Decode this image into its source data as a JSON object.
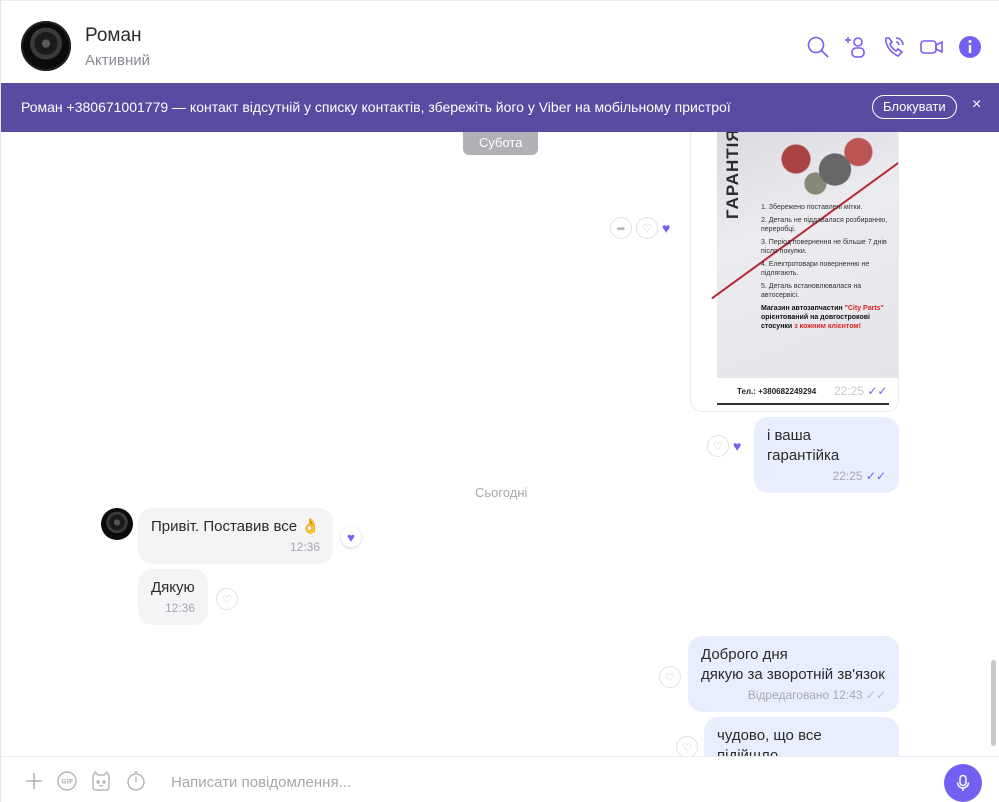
{
  "header": {
    "contact_name": "Роман",
    "contact_status": "Активний",
    "icons": [
      "search-icon",
      "add-participant-icon",
      "voice-call-icon",
      "video-call-icon",
      "info-icon"
    ]
  },
  "banner": {
    "text": "Роман +380671001779 — контакт відсутній у списку контактів, збережіть його у Viber на мобільному пристрої",
    "block_label": "Блокувати",
    "close_glyph": "×"
  },
  "chat": {
    "date_saturday": "Субота",
    "date_today": "Сьогодні",
    "image_message": {
      "poster_title": "ГАРАНТІЯ",
      "poster_items": [
        "1. Збережено поставлені мітки.",
        "2. Деталь не піддавалася розбиранню, переробці.",
        "3. Період повернення не більше 7 днів після покупки.",
        "4. Електротовари поверненню не підлягають.",
        "5. Деталь встановлювалася на автосервісі."
      ],
      "poster_promo_a": "Магазин автозапчастин ",
      "poster_promo_brand": "\"City Parts\"",
      "poster_promo_b": " орієнтований на довгострокові стосунки ",
      "poster_promo_c": "з кожним клієнтом!",
      "phone": "Тел.: +380682249294",
      "time": "22:25",
      "ticks": "✓✓"
    },
    "messages": [
      {
        "id": "m1",
        "direction": "out",
        "text": "і ваша гарантійка",
        "time": "22:25",
        "ticks": "✓✓"
      },
      {
        "id": "m2",
        "direction": "in",
        "text": "Привіт. Поставив все 👌",
        "time": "12:36"
      },
      {
        "id": "m3",
        "direction": "in",
        "text": "Дякую",
        "time": "12:36"
      },
      {
        "id": "m4",
        "direction": "out",
        "text_line1": "Доброго дня",
        "text_line2": "дякую за зворотній зв'язок",
        "time": "Відредаговано 12:43",
        "ticks": "✓✓"
      },
      {
        "id": "m5",
        "direction": "out",
        "text": "чудово, що все підійшло"
      }
    ]
  },
  "composer": {
    "placeholder": "Написати повідомлення...",
    "icons": [
      "plus-icon",
      "gif-icon",
      "sticker-icon",
      "timer-icon",
      "microphone-icon"
    ]
  },
  "colors": {
    "accent": "#7360f2",
    "banner_bg": "#574ba2",
    "outgoing_bubble": "#e9eefe",
    "incoming_bubble": "#f4f4f6"
  }
}
